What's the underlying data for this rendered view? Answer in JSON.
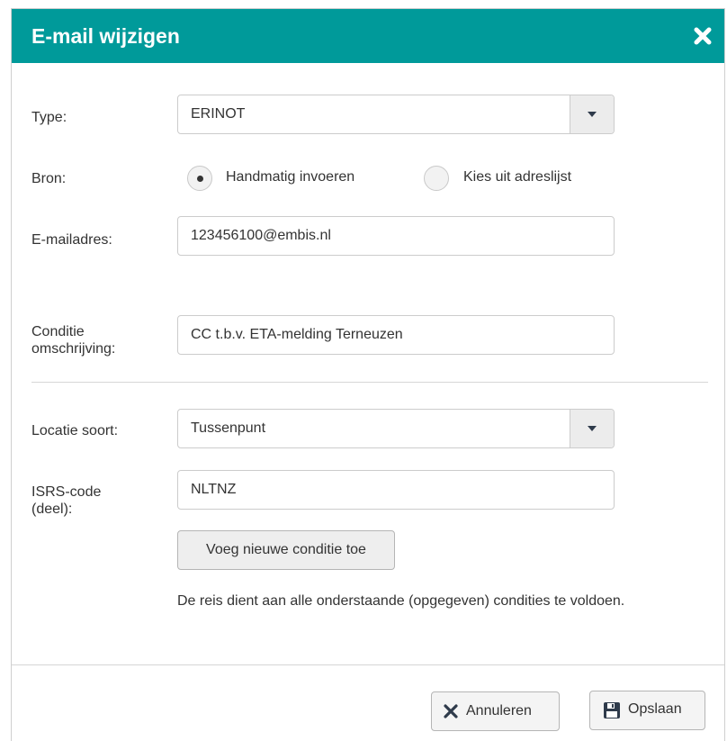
{
  "dialog": {
    "title": "E-mail wijzigen",
    "header_color": "#009a9a"
  },
  "form": {
    "type_label": "Type:",
    "type_value": "ERINOT",
    "bron_label": "Bron:",
    "bron_options": [
      {
        "label": "Handmatig invoeren",
        "selected": true
      },
      {
        "label": "Kies uit adreslijst",
        "selected": false
      }
    ],
    "email_label": "E-mailadres:",
    "email_value": "123456100@embis.nl",
    "conditie_label_line1": "Conditie",
    "conditie_label_line2": "omschrijving:",
    "conditie_value": "CC t.b.v. ETA-melding Terneuzen",
    "locatie_label": "Locatie soort:",
    "locatie_value": "Tussenpunt",
    "isrs_label_line1": "ISRS-code",
    "isrs_label_line2": "(deel):",
    "isrs_value": "NLTNZ",
    "add_condition_label": "Voeg nieuwe conditie toe",
    "note": "De reis dient aan alle onderstaande (opgegeven) condities te voldoen."
  },
  "footer": {
    "cancel_label": "Annuleren",
    "save_label": "Opslaan"
  },
  "icons": {
    "close": "close-icon",
    "dropdown": "caret-down-icon",
    "cancel": "x-icon",
    "save": "floppy-disk-icon"
  }
}
